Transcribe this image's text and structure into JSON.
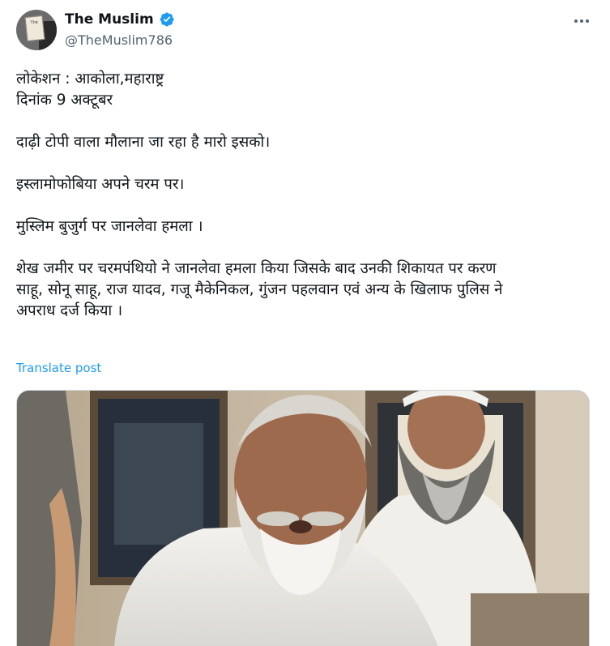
{
  "author": {
    "display_name": "The Muslim",
    "handle": "@TheMuslim786",
    "verified_color": "#1d9bf0",
    "avatar_sign_text": "The"
  },
  "post": {
    "lines": [
      "लोकेशन : आकोला,महाराष्ट्र",
      "दिनांक 9 अक्टूबर",
      "",
      "दाढ़ी टोपी वाला मौलाना जा रहा है मारो इसको।",
      "",
      "इस्लामोफोबिया अपने चरम पर।",
      "",
      "मुस्लिम बुजुर्ग पर जानलेवा हमला ।",
      "",
      "शेख जमीर पर चरमपंथियो ने जानलेवा हमला किया जिसके बाद उनकी शिकायत पर करण",
      "साहू, सोनू साहू, राज यादव, गजू मैकेनिकल, गुंजन पहलवान एवं अन्य के खिलाफ पुलिस ने",
      "अपराध दर्ज किया ।"
    ],
    "translate_label": "Translate post"
  },
  "icons": {
    "more": "more-icon",
    "verified": "verified-badge-icon"
  },
  "colors": {
    "text": "#0f1419",
    "secondary": "#536471",
    "link": "#1d9bf0",
    "border": "#cfd9de"
  }
}
